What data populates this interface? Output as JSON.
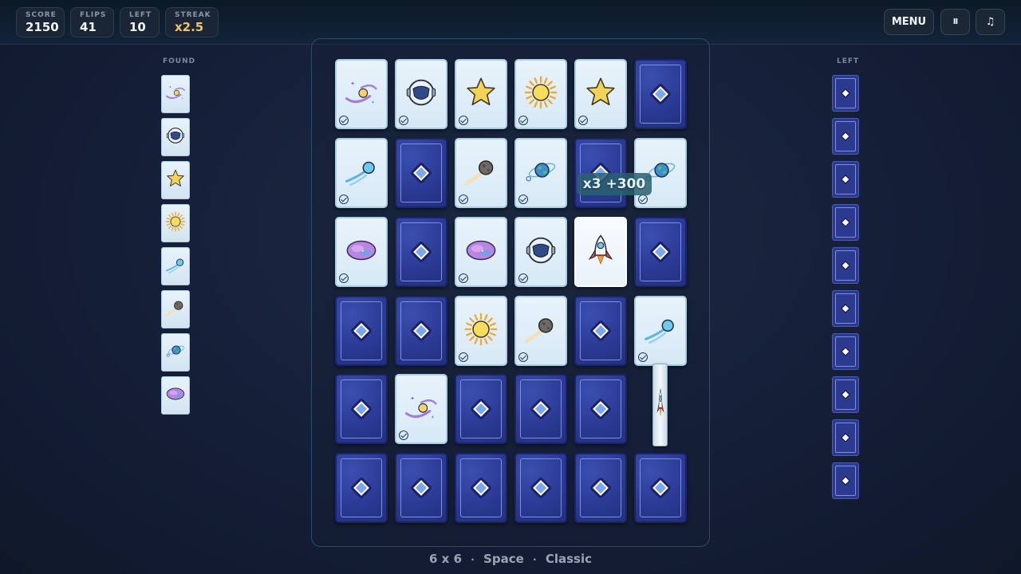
{
  "hud": {
    "stats": [
      {
        "label": "SCORE",
        "value": "2150"
      },
      {
        "label": "FLIPS",
        "value": "41"
      },
      {
        "label": "LEFT",
        "value": "10"
      },
      {
        "label": "STREAK",
        "value": "x2.5"
      }
    ],
    "buttons": {
      "menu": "MENU",
      "pause": "II",
      "music": "♫"
    }
  },
  "combo_popup": "x3  +300",
  "side_panels": {
    "found_title": "FOUND",
    "left_title": "LEFT"
  },
  "found_pairs": [
    "galaxy-swirl",
    "astronaut-helmet",
    "star",
    "sun",
    "comet",
    "meteor",
    "planet-earth",
    "nebula"
  ],
  "left_count_cards": 10,
  "board": {
    "grid": "6 x 6",
    "theme": "Space",
    "mode": "Classic",
    "separator": "·",
    "cards": [
      {
        "row": 0,
        "col": 0,
        "state": "matched",
        "symbol": "galaxy-swirl"
      },
      {
        "row": 0,
        "col": 1,
        "state": "matched",
        "symbol": "astronaut-helmet"
      },
      {
        "row": 0,
        "col": 2,
        "state": "matched",
        "symbol": "star"
      },
      {
        "row": 0,
        "col": 3,
        "state": "matched",
        "symbol": "sun"
      },
      {
        "row": 0,
        "col": 4,
        "state": "matched",
        "symbol": "star"
      },
      {
        "row": 0,
        "col": 5,
        "state": "hidden"
      },
      {
        "row": 1,
        "col": 0,
        "state": "matched",
        "symbol": "comet"
      },
      {
        "row": 1,
        "col": 1,
        "state": "hidden"
      },
      {
        "row": 1,
        "col": 2,
        "state": "matched",
        "symbol": "meteor"
      },
      {
        "row": 1,
        "col": 3,
        "state": "matched",
        "symbol": "planet-earth"
      },
      {
        "row": 1,
        "col": 4,
        "state": "hidden"
      },
      {
        "row": 1,
        "col": 5,
        "state": "matched",
        "symbol": "planet-earth"
      },
      {
        "row": 2,
        "col": 0,
        "state": "matched",
        "symbol": "nebula"
      },
      {
        "row": 2,
        "col": 1,
        "state": "hidden"
      },
      {
        "row": 2,
        "col": 2,
        "state": "matched",
        "symbol": "nebula"
      },
      {
        "row": 2,
        "col": 3,
        "state": "matched",
        "symbol": "astronaut-helmet"
      },
      {
        "row": 2,
        "col": 4,
        "state": "revealed",
        "symbol": "rocket"
      },
      {
        "row": 2,
        "col": 5,
        "state": "hidden"
      },
      {
        "row": 3,
        "col": 0,
        "state": "hidden"
      },
      {
        "row": 3,
        "col": 1,
        "state": "hidden"
      },
      {
        "row": 3,
        "col": 2,
        "state": "matched",
        "symbol": "sun"
      },
      {
        "row": 3,
        "col": 3,
        "state": "matched",
        "symbol": "meteor"
      },
      {
        "row": 3,
        "col": 4,
        "state": "hidden"
      },
      {
        "row": 3,
        "col": 5,
        "state": "matched",
        "symbol": "comet"
      },
      {
        "row": 4,
        "col": 0,
        "state": "hidden"
      },
      {
        "row": 4,
        "col": 1,
        "state": "matched",
        "symbol": "galaxy-swirl"
      },
      {
        "row": 4,
        "col": 2,
        "state": "hidden"
      },
      {
        "row": 4,
        "col": 3,
        "state": "hidden"
      },
      {
        "row": 4,
        "col": 4,
        "state": "hidden"
      },
      {
        "row": 4,
        "col": 5,
        "state": "flipping",
        "symbol": "rocket"
      },
      {
        "row": 5,
        "col": 0,
        "state": "hidden"
      },
      {
        "row": 5,
        "col": 1,
        "state": "hidden"
      },
      {
        "row": 5,
        "col": 2,
        "state": "hidden"
      },
      {
        "row": 5,
        "col": 3,
        "state": "hidden"
      },
      {
        "row": 5,
        "col": 4,
        "state": "hidden"
      },
      {
        "row": 5,
        "col": 5,
        "state": "hidden"
      }
    ]
  },
  "colors": {
    "card_back": "#2b3a94",
    "card_face": "#e3f0f9",
    "streak_gold": "#f0c46b",
    "popup_teal": "#2b6070"
  }
}
